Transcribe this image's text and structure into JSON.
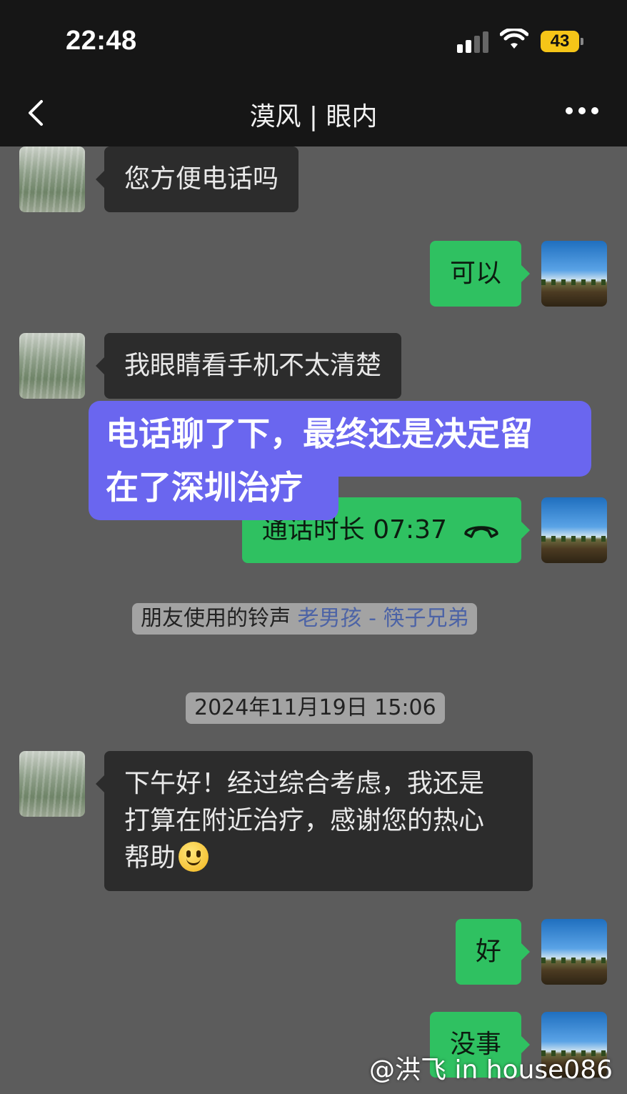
{
  "status_bar": {
    "time": "22:48",
    "battery": "43"
  },
  "nav": {
    "title": "漠风 | 眼内"
  },
  "messages": [
    {
      "side": "in",
      "text": "您方便电话吗"
    },
    {
      "side": "out",
      "text": "可以"
    },
    {
      "side": "in",
      "text": "我眼睛看手机不太清楚"
    },
    {
      "side": "out",
      "text": "通话时长 07:37"
    },
    {
      "side": "in",
      "text_lines": [
        "下午好！经过综合考虑，我还是",
        "打算在附近治疗，感谢您的热心",
        "帮助"
      ]
    },
    {
      "side": "out",
      "text": "好"
    },
    {
      "side": "out",
      "text": "没事"
    }
  ],
  "system": {
    "ringtone_prefix": "朋友使用的铃声",
    "ringtone_song": "老男孩 - 筷子兄弟",
    "timestamp": "2024年11月19日 15:06"
  },
  "overlay": {
    "line1": "电话聊了下，最终还是决定留",
    "line2": "在了深圳治疗"
  },
  "watermark": "@洪飞 in house086",
  "colors": {
    "out_bubble": "#2fc161",
    "in_bubble": "#2c2c2c",
    "overlay": "#6a66ef",
    "chat_bg": "#5c5c5c"
  },
  "icons": [
    "back-chevron-icon",
    "more-dots-icon",
    "signal-icon",
    "wifi-icon",
    "battery-icon",
    "phone-hangup-icon",
    "smiley-emoji-icon"
  ]
}
